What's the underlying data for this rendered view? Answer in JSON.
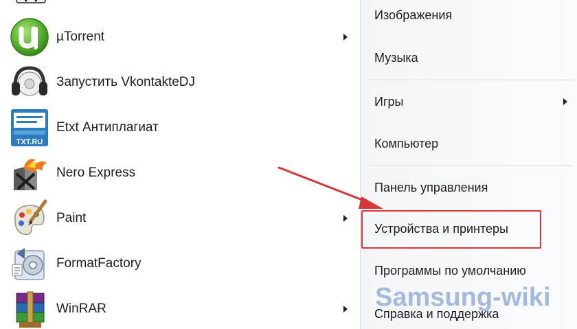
{
  "programs": [
    {
      "label": "µTorrent",
      "icon": "utorrent-icon",
      "has_submenu": true
    },
    {
      "label": "Запустить VkontakteDJ",
      "icon": "vkontaktedj-headphones-icon",
      "has_submenu": false
    },
    {
      "label": "Etxt Антиплагиат",
      "icon": "etxt-antiplagiat-icon",
      "has_submenu": false
    },
    {
      "label": "Nero Express",
      "icon": "nero-express-icon",
      "has_submenu": false
    },
    {
      "label": "Paint",
      "icon": "paint-palette-icon",
      "has_submenu": true
    },
    {
      "label": "FormatFactory",
      "icon": "formatfactory-icon",
      "has_submenu": false
    },
    {
      "label": "WinRAR",
      "icon": "winrar-books-icon",
      "has_submenu": true
    }
  ],
  "etxt_icon_text": "TXT.RU",
  "right_menu": {
    "pictures": "Изображения",
    "music": "Музыка",
    "games": "Игры",
    "computer": "Компьютер",
    "control_panel": "Панель управления",
    "devices_printers": "Устройства и принтеры",
    "default_programs": "Программы по умолчанию",
    "help_support": "Справка и поддержка"
  },
  "watermark": "Samsung-wiki",
  "colors": {
    "highlight": "#d8373a",
    "arrow": "#d8373a",
    "watermark": "#9db4dc"
  }
}
